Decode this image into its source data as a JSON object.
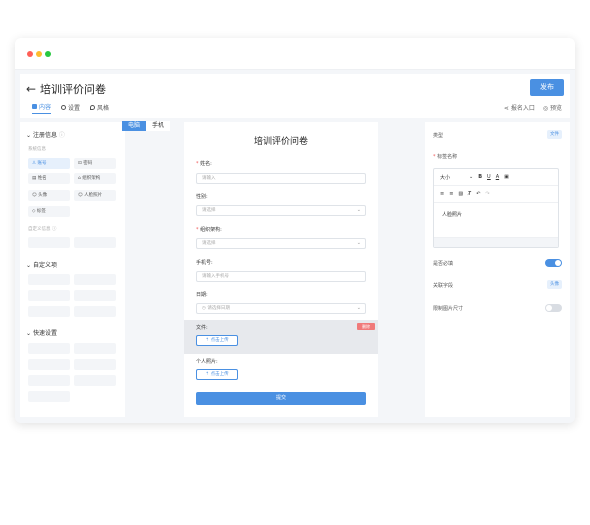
{
  "header": {
    "back_icon": "←",
    "title": "培训评价问卷",
    "publish_label": "发布",
    "tabs": [
      {
        "label": "内容"
      },
      {
        "label": "设置"
      },
      {
        "label": "风格"
      }
    ],
    "share_label": "报名入口",
    "preview_label": "预览"
  },
  "left": {
    "section1_title": "注册信息",
    "system_label": "系统信息",
    "chips": [
      "账号",
      "密码",
      "姓名",
      "组织架构",
      "头像",
      "人脸照片",
      "标签"
    ],
    "custom_label": "自定义信息",
    "section2_title": "自定义项",
    "section3_title": "快速设置"
  },
  "device_tabs": {
    "pc": "电脑",
    "mobile": "手机"
  },
  "form": {
    "title": "培训评价问卷",
    "name_label": "姓名:",
    "name_placeholder": "请输入",
    "gender_label": "性别:",
    "gender_placeholder": "请选择",
    "org_label": "组织架构:",
    "org_placeholder": "请选择",
    "phone_label": "手机号:",
    "phone_placeholder": "请输入手机号",
    "date_label": "日期:",
    "date_placeholder": "请选择日期",
    "file_label": "文件:",
    "delete_label": "删除",
    "upload_label": "点击上传",
    "photo_label": "个人照片:",
    "submit_label": "提交"
  },
  "right": {
    "type_label": "类型",
    "type_value": "文件",
    "tag_name_label": "标签名称",
    "toolbar_size": "大小",
    "editor_text": "人脸照片",
    "required_label": "是否必填",
    "link_field_label": "关联字段",
    "link_field_value": "头像",
    "limit_label": "限制图片尺寸"
  },
  "colors": {
    "accent": "#4a90e2",
    "danger": "#f07a7a"
  }
}
